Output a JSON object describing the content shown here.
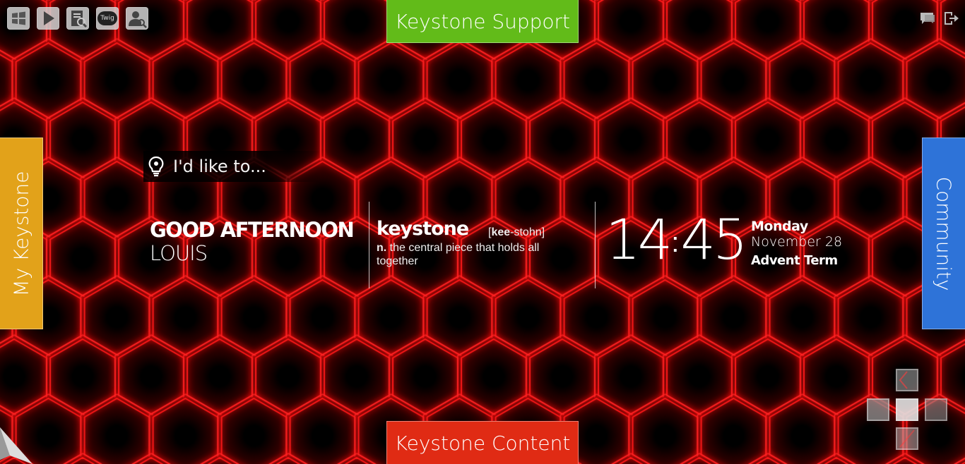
{
  "toolbar": {
    "icons": [
      "windows-icon",
      "play-icon",
      "document-search-icon",
      "twig-icon",
      "user-search-icon"
    ],
    "twig_label": "Twig"
  },
  "top_right": {
    "icons": [
      "chat-icon",
      "logout-icon"
    ]
  },
  "tabs": {
    "top": "Keystone Support",
    "bottom": "Keystone Content",
    "left": "My Keystone",
    "right": "Community"
  },
  "tabs_colors": {
    "top": "#62bb19",
    "bottom": "#e02b14",
    "left": "#e2a21a",
    "right": "#2e73d8"
  },
  "prompt": {
    "icon": "lightbulb-icon",
    "text": "I'd like to..."
  },
  "greeting": {
    "line1": "GOOD AFTERNOON",
    "name": "LOUIS"
  },
  "definition": {
    "word": "keystone",
    "pronunciation_bold": "kee",
    "pronunciation_rest": "-stohn",
    "pos": "n.",
    "meaning": "the central piece that holds all together"
  },
  "clock": {
    "hours": "14",
    "separator": ":",
    "minutes": "45"
  },
  "date": {
    "weekday": "Monday",
    "month_day": "November 28",
    "term": "Advent Term"
  },
  "background": {
    "accent": "#ff1a1a",
    "base": "#000000"
  }
}
